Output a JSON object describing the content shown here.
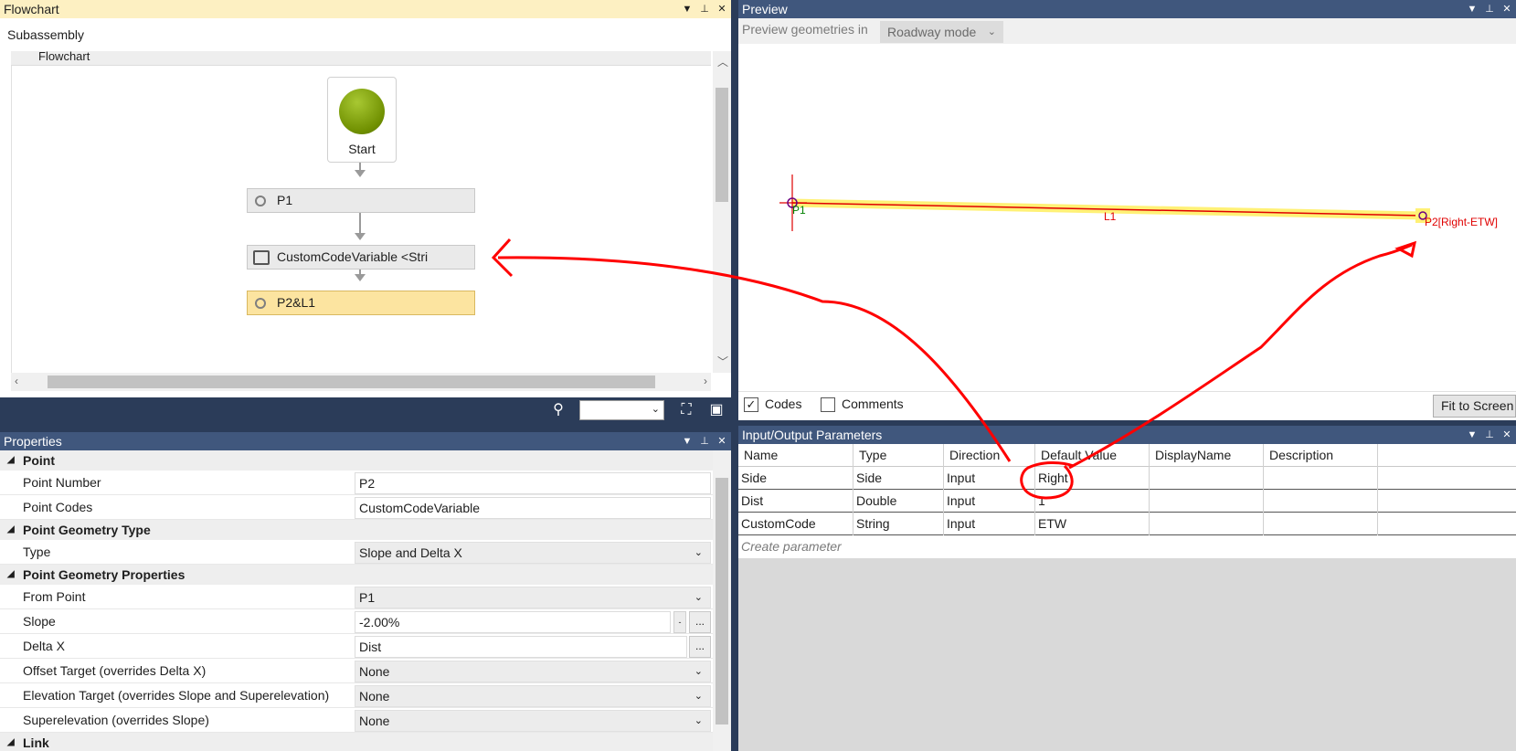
{
  "flowchart": {
    "title": "Flowchart",
    "subassembly_label": "Subassembly",
    "breadcrumb": "Flowchart",
    "start_label": "Start",
    "nodes": [
      {
        "label": "P1"
      },
      {
        "label": "CustomCodeVariable <Stri"
      },
      {
        "label": "P2&L1"
      }
    ]
  },
  "properties": {
    "title": "Properties",
    "groups": [
      {
        "name": "Point",
        "rows": [
          {
            "name": "Point Number",
            "value": "P2"
          },
          {
            "name": "Point Codes",
            "value": "CustomCodeVariable"
          }
        ]
      },
      {
        "name": "Point Geometry Type",
        "rows": [
          {
            "name": "Type",
            "value": "Slope and Delta X"
          }
        ]
      },
      {
        "name": "Point Geometry Properties",
        "rows": [
          {
            "name": "From Point",
            "value": "P1"
          },
          {
            "name": "Slope",
            "value": "-2.00%"
          },
          {
            "name": "Delta X",
            "value": "Dist"
          },
          {
            "name": "Offset Target (overrides Delta X)",
            "value": "None"
          },
          {
            "name": "Elevation Target (overrides Slope and Superelevation)",
            "value": "None"
          },
          {
            "name": "Superelevation (overrides Slope)",
            "value": "None"
          }
        ]
      },
      {
        "name": "Link",
        "rows": []
      }
    ],
    "more_button": "..."
  },
  "preview": {
    "title": "Preview",
    "geom_label": "Preview geometries in",
    "mode": "Roadway mode",
    "p1_label": "P1",
    "l1_label": "L1",
    "p2_label": "P2[Right-ETW]",
    "codes_label": "Codes",
    "codes_checked": true,
    "comments_label": "Comments",
    "comments_checked": false,
    "fit_button": "Fit to Screen"
  },
  "io": {
    "title": "Input/Output Parameters",
    "columns": [
      "Name",
      "Type",
      "Direction",
      "Default Value",
      "DisplayName",
      "Description"
    ],
    "rows": [
      [
        "Side",
        "Side",
        "Input",
        "Right",
        "",
        ""
      ],
      [
        "Dist",
        "Double",
        "Input",
        "1",
        "",
        ""
      ],
      [
        "CustomCode",
        "String",
        "Input",
        "ETW",
        "",
        ""
      ]
    ],
    "create_placeholder": "Create parameter"
  },
  "colors": {
    "active_title": "#fdf0c2",
    "inactive_title": "#40577d",
    "frame": "#2b3c59",
    "annotation": "#ff0000",
    "selected_node": "#fce4a0"
  }
}
